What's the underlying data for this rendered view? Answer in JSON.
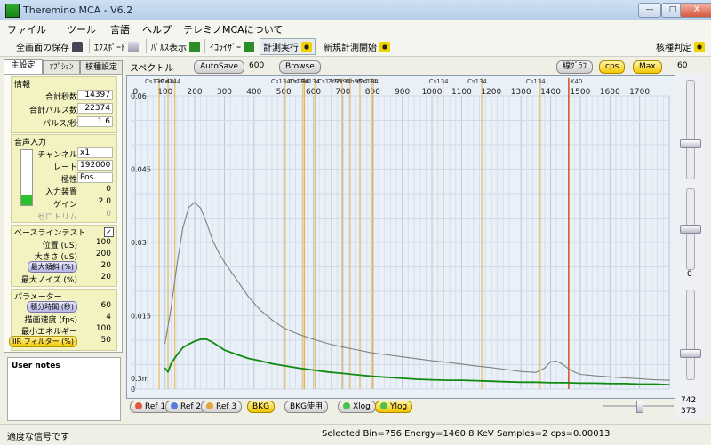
{
  "window": {
    "title": "Theremino MCA - V6.2",
    "minimize": "—",
    "maximize": "□",
    "close": "X"
  },
  "menu": [
    "ファイル",
    "ツール",
    "言語",
    "ヘルプ",
    "テレミノMCAについて"
  ],
  "toolbar": {
    "save": "全画面の保存",
    "export": "ｴｸｽﾎﾟｰﾄ",
    "pulse": "ﾊﾟﾙｽ表示",
    "equalizer": "ｲｺﾗｲｻﾞｰ",
    "run": "計測実行",
    "new_run": "新規計測開始",
    "nuclide": "核種判定"
  },
  "tabs": [
    "主設定",
    "ｵﾌﾟｼｮﾝ",
    "核種設定"
  ],
  "info": {
    "title": "情報",
    "rows": [
      {
        "label": "合計秒数",
        "value": "14397"
      },
      {
        "label": "合計パルス数",
        "value": "22374"
      },
      {
        "label": "パルス/秒",
        "value": "1.6"
      }
    ]
  },
  "audio": {
    "title": "音声入力",
    "rows": [
      {
        "label": "チャンネル",
        "value": "x1"
      },
      {
        "label": "レート",
        "value": "192000"
      },
      {
        "label": "極性",
        "value": "Pos."
      },
      {
        "label": "入力装置",
        "value": "0"
      },
      {
        "label": "ゲイン",
        "value": "2.0"
      },
      {
        "label": "ゼロトリム",
        "value": "0"
      }
    ]
  },
  "baseline": {
    "title": "ベースラインテスト",
    "check": "✓",
    "rows": [
      {
        "label": "位置 (uS)",
        "value": "100"
      },
      {
        "label": "大きさ (uS)",
        "value": "200"
      },
      {
        "label": "最大傾斜 (%)",
        "value": "20"
      },
      {
        "label": "最大ノイズ (%)",
        "value": "20"
      }
    ]
  },
  "params": {
    "title": "パラメーター",
    "rows": [
      {
        "label": "積分時間 (秒)",
        "value": "60"
      },
      {
        "label": "描画速度 (fps)",
        "value": "4"
      },
      {
        "label": "最小エネルギー",
        "value": "100"
      },
      {
        "label": "IIR フィルター (%)",
        "value": "50"
      }
    ]
  },
  "notes": {
    "title": "User notes"
  },
  "spectrum_head": {
    "label": "スペクトル",
    "autosave": "AutoSave",
    "autosave_value": "600",
    "browse": "Browse",
    "graph_type": "線ｸﾞﾗﾌ",
    "cps": "cps",
    "max": "Max",
    "max_value": "60"
  },
  "bottom_buttons": {
    "ref1": "Ref 1",
    "ref2": "Ref 2",
    "ref3": "Ref 3",
    "bkg": "BKG",
    "bkg_use": "BKG使用",
    "xlog": "Xlog",
    "ylog": "Ylog"
  },
  "right_values": {
    "mid": "0",
    "low1": "742",
    "low2": "373"
  },
  "status": {
    "left": "適度な信号です",
    "right": "Selected Bin=756  Energy=1460.8 KeV  Samples=2  cps=0.00013"
  },
  "colors": {
    "gray_series": "#808080",
    "green_series": "#108a10",
    "marker_line": "#e8b040",
    "selected_line": "#d65020",
    "plot_bg": "#e9f0f8"
  },
  "chart_data": {
    "type": "line",
    "xlim": [
      -10,
      1800
    ],
    "ylim": [
      0,
      0.06
    ],
    "x_ticks": [
      0,
      100,
      200,
      300,
      400,
      500,
      600,
      700,
      800,
      900,
      1000,
      1100,
      1200,
      1300,
      1400,
      1500,
      1600,
      1700
    ],
    "y_tick_labels": [
      {
        "v": 0.06,
        "t": "0.06"
      },
      {
        "v": 0.045,
        "t": "0.045"
      },
      {
        "v": 0.03,
        "t": "0.03"
      },
      {
        "v": 0.015,
        "t": "0.015"
      },
      {
        "v": 0.0022,
        "t": "0.3m"
      },
      {
        "v": 0,
        "t": "0"
      }
    ],
    "markers": [
      {
        "x": 80,
        "label": "Cs137"
      },
      {
        "x": 110,
        "label": "Ce144"
      },
      {
        "x": 133,
        "label": "Ce144"
      },
      {
        "x": 505,
        "label": "Cs134"
      },
      {
        "x": 565,
        "label": "Cs134"
      },
      {
        "x": 570,
        "label": "Cs134"
      },
      {
        "x": 605,
        "label": "Cs134"
      },
      {
        "x": 662,
        "label": "Cs137"
      },
      {
        "x": 697,
        "label": "Zr95"
      },
      {
        "x": 724,
        "label": "Zr95"
      },
      {
        "x": 757,
        "label": "Nb95"
      },
      {
        "x": 796,
        "label": "Cs134"
      },
      {
        "x": 802,
        "label": "Cs134"
      },
      {
        "x": 1038,
        "label": "Cs134"
      },
      {
        "x": 1168,
        "label": "Cs134"
      },
      {
        "x": 1365,
        "label": "Cs134"
      }
    ],
    "selected": {
      "x": 1461,
      "label": "K40"
    },
    "series": [
      {
        "x": [
          100,
          120,
          140,
          160,
          180,
          200,
          220,
          240,
          260,
          280,
          300,
          340,
          380,
          420,
          460,
          500,
          550,
          600,
          650,
          700,
          750,
          800,
          850,
          900,
          950,
          1000,
          1050,
          1100,
          1150,
          1200,
          1250,
          1300,
          1350,
          1380,
          1400,
          1420,
          1440,
          1460,
          1480,
          1500,
          1550,
          1600,
          1650,
          1700,
          1750,
          1800
        ],
        "values": [
          0.0094,
          0.0165,
          0.0255,
          0.033,
          0.0372,
          0.0382,
          0.037,
          0.034,
          0.0305,
          0.028,
          0.026,
          0.0225,
          0.019,
          0.0162,
          0.0142,
          0.0125,
          0.0112,
          0.0102,
          0.0093,
          0.0086,
          0.008,
          0.0074,
          0.007,
          0.0066,
          0.0062,
          0.0058,
          0.0055,
          0.0051,
          0.0047,
          0.0044,
          0.004,
          0.0036,
          0.0034,
          0.0043,
          0.0056,
          0.0057,
          0.0051,
          0.0042,
          0.0035,
          0.003,
          0.0027,
          0.0025,
          0.0023,
          0.0021,
          0.0019,
          0.0018
        ]
      },
      {
        "x": [
          100,
          110,
          120,
          140,
          160,
          180,
          200,
          220,
          240,
          260,
          280,
          300,
          340,
          380,
          420,
          460,
          500,
          550,
          600,
          650,
          700,
          750,
          800,
          850,
          900,
          950,
          1000,
          1050,
          1100,
          1150,
          1200,
          1250,
          1300,
          1350,
          1400,
          1450,
          1500,
          1550,
          1600,
          1650,
          1700,
          1750,
          1800
        ],
        "values": [
          0.0043,
          0.0035,
          0.0052,
          0.007,
          0.0085,
          0.0092,
          0.0098,
          0.0102,
          0.0102,
          0.0096,
          0.0088,
          0.008,
          0.0071,
          0.0063,
          0.0058,
          0.0052,
          0.0048,
          0.0043,
          0.0039,
          0.0035,
          0.0032,
          0.0029,
          0.0026,
          0.0024,
          0.0022,
          0.002,
          0.0019,
          0.0018,
          0.0018,
          0.0017,
          0.0016,
          0.0015,
          0.0014,
          0.0014,
          0.0013,
          0.0013,
          0.0012,
          0.0012,
          0.0011,
          0.0011,
          0.001,
          0.001,
          0.0009
        ]
      }
    ]
  }
}
